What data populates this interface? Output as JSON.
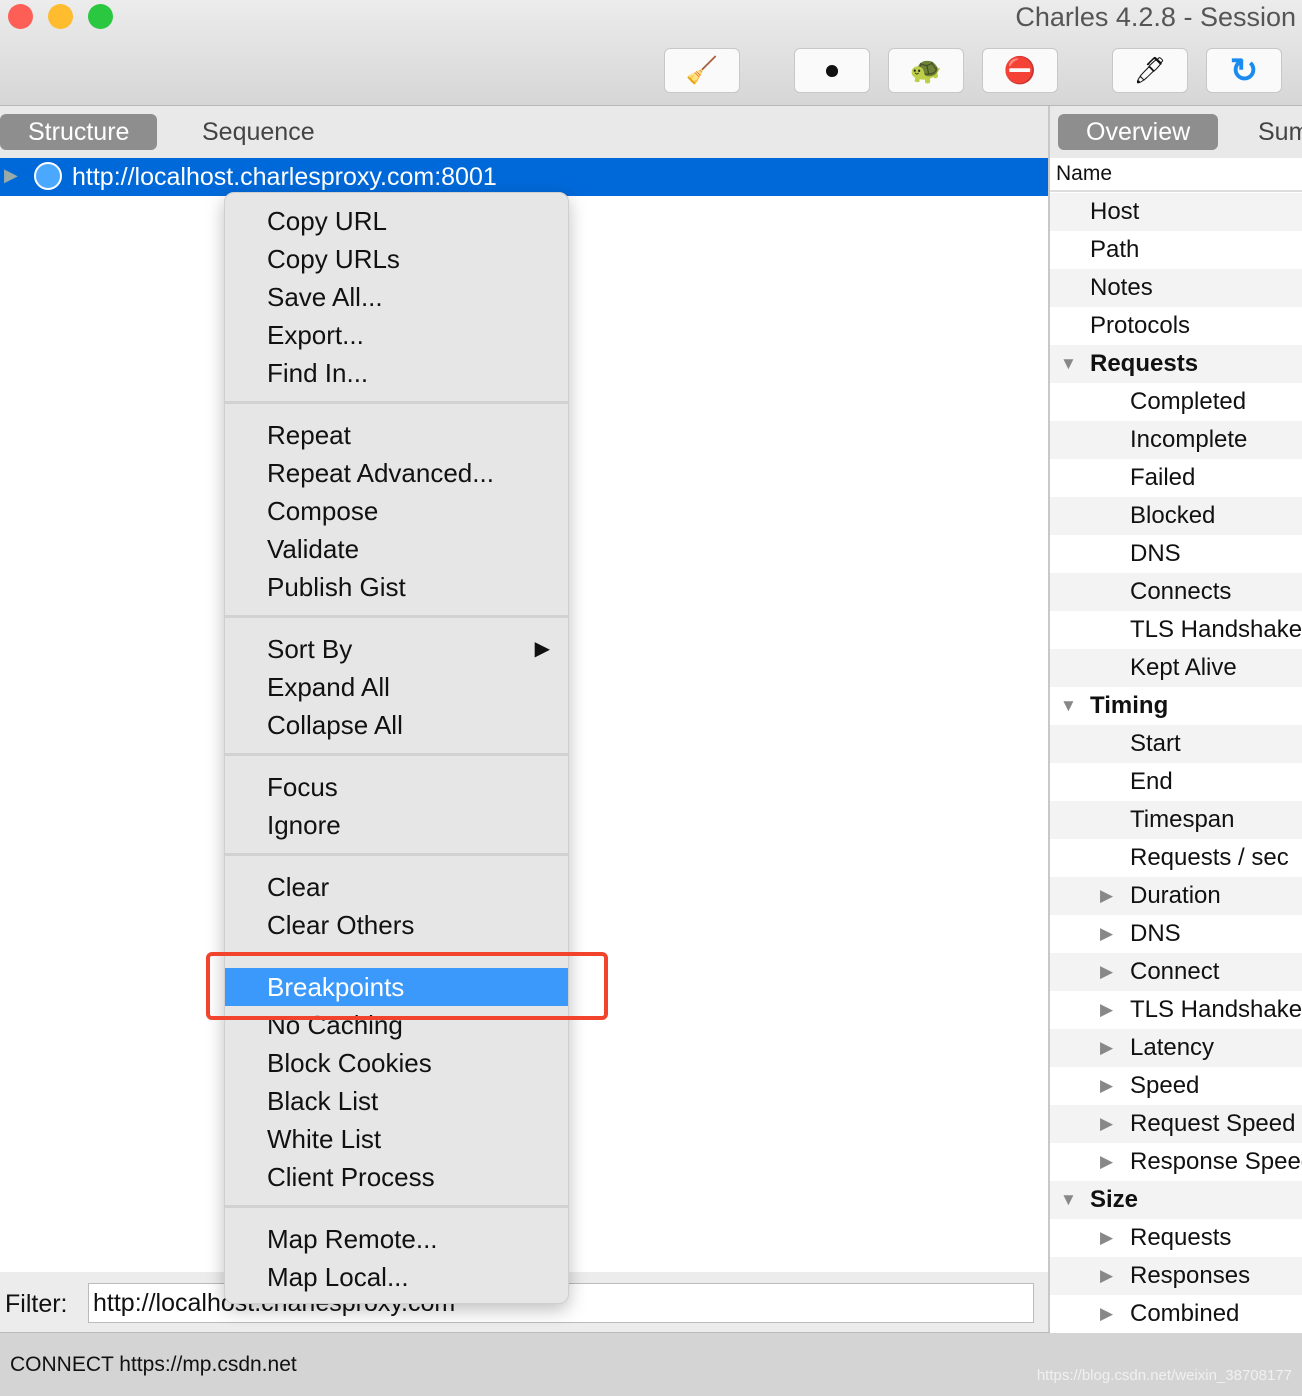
{
  "window": {
    "title": "Charles 4.2.8 - Session"
  },
  "toolbar": {
    "buttons": [
      {
        "icon": "broom-icon",
        "glyph": "🧹"
      },
      {
        "icon": "record-icon",
        "glyph": "⏺"
      },
      {
        "icon": "turtle-icon",
        "glyph": "🐢"
      },
      {
        "icon": "breakpoint-stop-icon",
        "glyph": "⛔"
      },
      {
        "icon": "pen-icon",
        "glyph": "🖊"
      },
      {
        "icon": "refresh-icon",
        "glyph": "↻"
      }
    ]
  },
  "left": {
    "tabs": [
      "Structure",
      "Sequence"
    ],
    "selected_host": "http://localhost.charlesproxy.com:8001"
  },
  "filter": {
    "label": "Filter:",
    "value": "http://localhost.charlesproxy.com"
  },
  "status": {
    "text": "CONNECT https://mp.csdn.net",
    "watermark": "https://blog.csdn.net/weixin_38708177"
  },
  "right": {
    "tabs": [
      "Overview",
      "Summary"
    ],
    "header": "Name",
    "rows": [
      {
        "label": "Host",
        "level": 1
      },
      {
        "label": "Path",
        "level": 1
      },
      {
        "label": "Notes",
        "level": 1
      },
      {
        "label": "Protocols",
        "level": 1
      },
      {
        "label": "Requests",
        "level": 1,
        "expanded": true,
        "bold": true
      },
      {
        "label": "Completed",
        "level": 2
      },
      {
        "label": "Incomplete",
        "level": 2
      },
      {
        "label": "Failed",
        "level": 2
      },
      {
        "label": "Blocked",
        "level": 2
      },
      {
        "label": "DNS",
        "level": 2
      },
      {
        "label": "Connects",
        "level": 2
      },
      {
        "label": "TLS Handshakes",
        "level": 2
      },
      {
        "label": "Kept Alive",
        "level": 2
      },
      {
        "label": "Timing",
        "level": 1,
        "expanded": true,
        "bold": true
      },
      {
        "label": "Start",
        "level": 2
      },
      {
        "label": "End",
        "level": 2
      },
      {
        "label": "Timespan",
        "level": 2
      },
      {
        "label": "Requests / sec",
        "level": 2
      },
      {
        "label": "Duration",
        "level": 2,
        "collapsed": true
      },
      {
        "label": "DNS",
        "level": 2,
        "collapsed": true
      },
      {
        "label": "Connect",
        "level": 2,
        "collapsed": true
      },
      {
        "label": "TLS Handshake",
        "level": 2,
        "collapsed": true
      },
      {
        "label": "Latency",
        "level": 2,
        "collapsed": true
      },
      {
        "label": "Speed",
        "level": 2,
        "collapsed": true
      },
      {
        "label": "Request Speed",
        "level": 2,
        "collapsed": true
      },
      {
        "label": "Response Speed",
        "level": 2,
        "collapsed": true
      },
      {
        "label": "Size",
        "level": 1,
        "expanded": true,
        "bold": true
      },
      {
        "label": "Requests",
        "level": 2,
        "collapsed": true
      },
      {
        "label": "Responses",
        "level": 2,
        "collapsed": true
      },
      {
        "label": "Combined",
        "level": 2,
        "collapsed": true
      }
    ]
  },
  "context_menu": {
    "groups": [
      [
        "Copy URL",
        "Copy URLs",
        "Save All...",
        "Export...",
        "Find In..."
      ],
      [
        "Repeat",
        "Repeat Advanced...",
        "Compose",
        "Validate",
        "Publish Gist"
      ],
      [
        "Sort By",
        "Expand All",
        "Collapse All"
      ],
      [
        "Focus",
        "Ignore"
      ],
      [
        "Clear",
        "Clear Others"
      ],
      [
        "Breakpoints",
        "No Caching",
        "Block Cookies",
        "Black List",
        "White List",
        "Client Process"
      ],
      [
        "Map Remote...",
        "Map Local..."
      ]
    ],
    "highlighted": "Breakpoints",
    "submenu_items": [
      "Sort By"
    ]
  },
  "colors": {
    "selection": "#0069d9",
    "menu_highlight": "#3b99fc",
    "annotation": "#f2432c"
  }
}
